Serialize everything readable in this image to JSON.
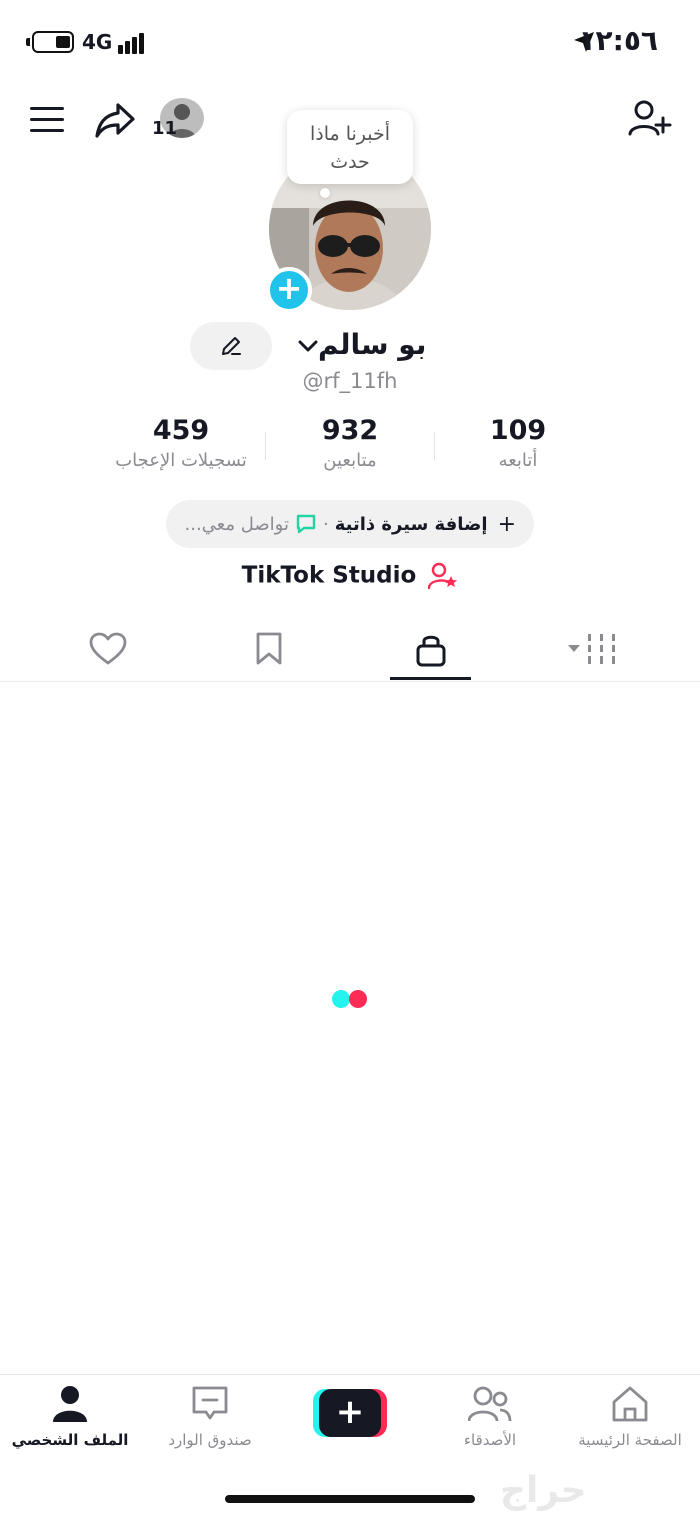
{
  "status_bar": {
    "network": "4G",
    "time": "١٢:٥٦"
  },
  "top_bar": {
    "visitor_count": "11"
  },
  "profile": {
    "note": [
      "أخبرنا ماذا",
      "حدث"
    ],
    "display_name": "بو سالم",
    "username": "@rf_11fh"
  },
  "stats": [
    {
      "value": "109",
      "label": "أتابعه"
    },
    {
      "value": "932",
      "label": "متابعين"
    },
    {
      "value": "459",
      "label": "تسجيلات الإعجاب"
    }
  ],
  "bio": {
    "plus": "+",
    "add_label": "إضافة سيرة ذاتية",
    "separator": "·",
    "contact_label": "تواصل معي..."
  },
  "studio": {
    "label": "TikTok Studio"
  },
  "tabs": [
    "videos-grid",
    "private",
    "favorites",
    "liked"
  ],
  "loader_colors": {
    "cyan": "#25f4ee",
    "pink": "#fe2c55"
  },
  "bottom_nav": [
    {
      "label": "الصفحة الرئيسية",
      "icon": "home-icon"
    },
    {
      "label": "الأصدقاء",
      "icon": "friends-icon"
    },
    {
      "label": "",
      "icon": "create-icon"
    },
    {
      "label": "صندوق الوارد",
      "icon": "inbox-icon"
    },
    {
      "label": "الملف الشخصي",
      "icon": "profile-icon"
    }
  ],
  "watermark": "حراج"
}
